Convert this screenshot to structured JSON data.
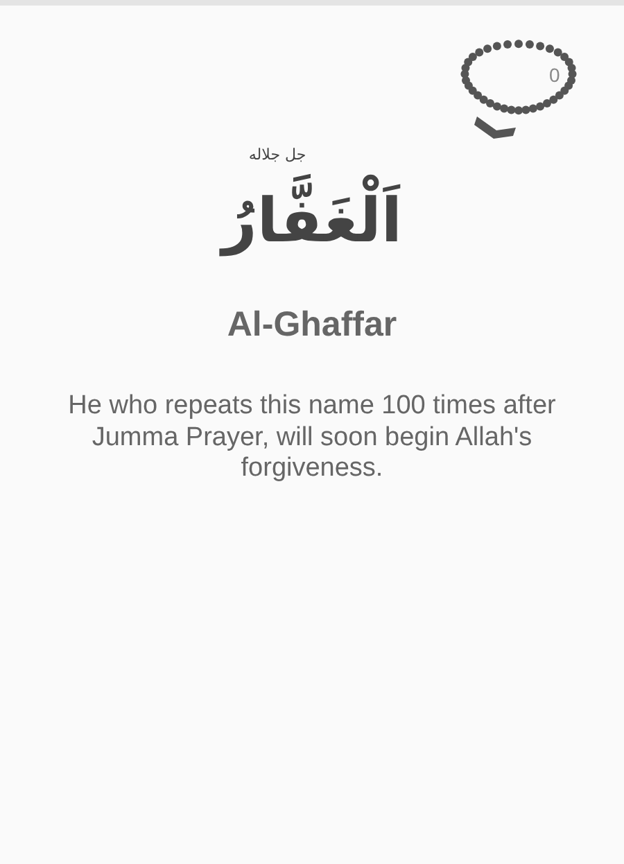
{
  "counter": {
    "count": "0"
  },
  "name": {
    "honorific": "جل جلاله",
    "arabic": "اَلْغَفَّارُ",
    "transliteration": "Al-Ghaffar"
  },
  "description": "He who repeats this name 100 times after Jumma Prayer, will soon begin Allah's forgiveness."
}
